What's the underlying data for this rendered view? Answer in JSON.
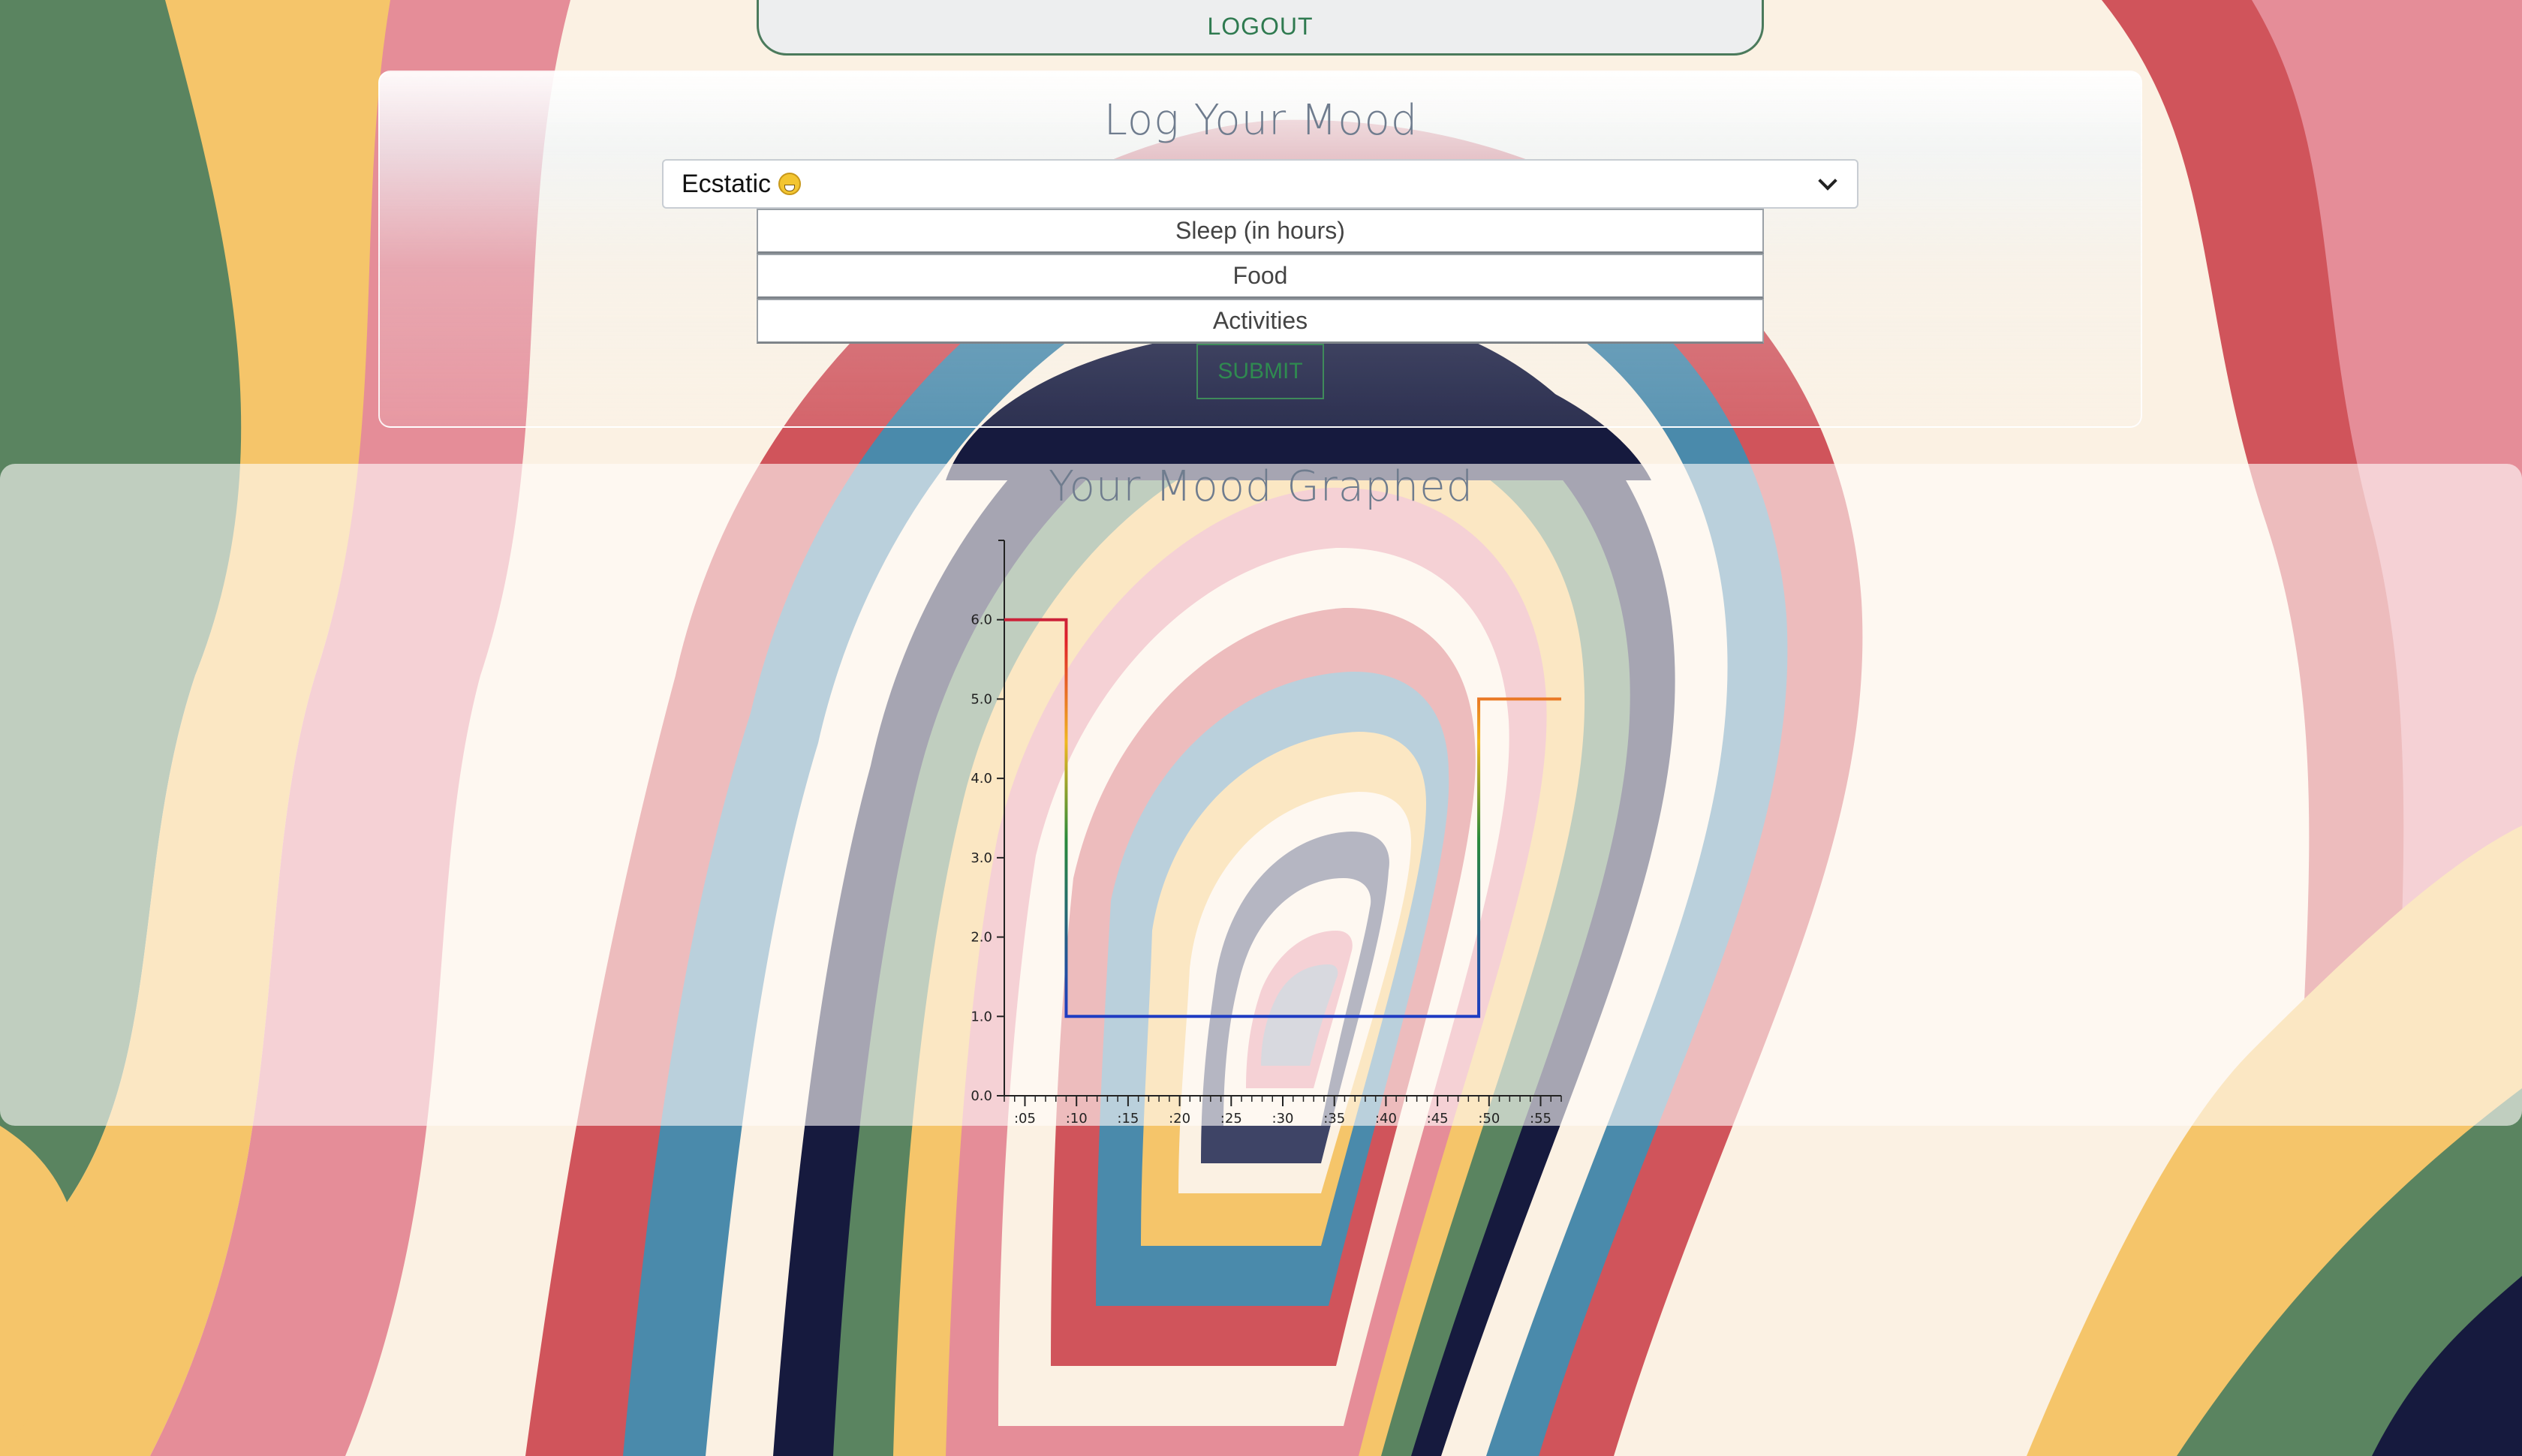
{
  "header": {
    "logout_label": "LOGOUT"
  },
  "mood_form": {
    "title": "Log Your Mood",
    "mood_select": {
      "selected": "Ecstatic"
    },
    "sleep_placeholder": "Sleep (in hours)",
    "food_placeholder": "Food",
    "activities_placeholder": "Activities",
    "submit_label": "SUBMIT"
  },
  "graph": {
    "title": "Your Mood Graphed"
  },
  "chart_data": {
    "type": "line",
    "title": "Your Mood Graphed",
    "x_tick_labels": [
      ":05",
      ":10",
      ":15",
      ":20",
      ":25",
      ":30",
      ":35",
      ":40",
      ":45",
      ":50",
      ":55"
    ],
    "y_tick_labels": [
      "0.0",
      "1.0",
      "2.0",
      "3.0",
      "4.0",
      "5.0",
      "6.0"
    ],
    "xlim": [
      3,
      57
    ],
    "ylim": [
      0,
      7
    ],
    "interpolation": "step-after",
    "series": [
      {
        "x": [
          3,
          9,
          49,
          57
        ],
        "y": [
          6,
          1,
          5,
          5
        ]
      }
    ],
    "colors": {
      "low": "#1a1aff",
      "mid": "#f0b820",
      "high": "#e0202a",
      "top": "#6a2a80"
    },
    "grid": false
  }
}
